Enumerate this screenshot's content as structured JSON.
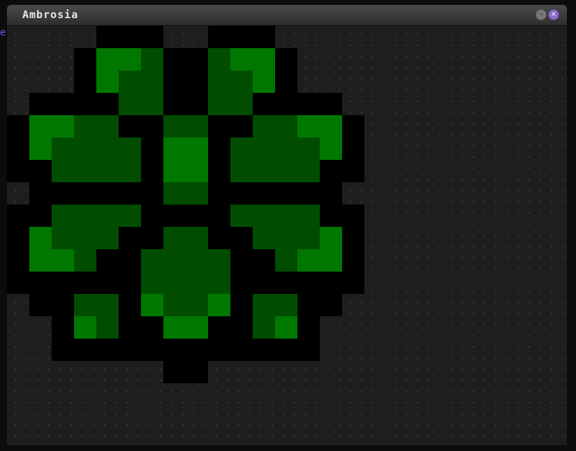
{
  "window": {
    "title": "Ambrosia"
  },
  "edge_text": "e",
  "palette": {
    "background": "#1e1e1e",
    "black": "#000000",
    "dark_green": "#004d00",
    "bright_green": "#007800"
  },
  "icons": [
    "minimize-icon",
    "close-icon"
  ]
}
